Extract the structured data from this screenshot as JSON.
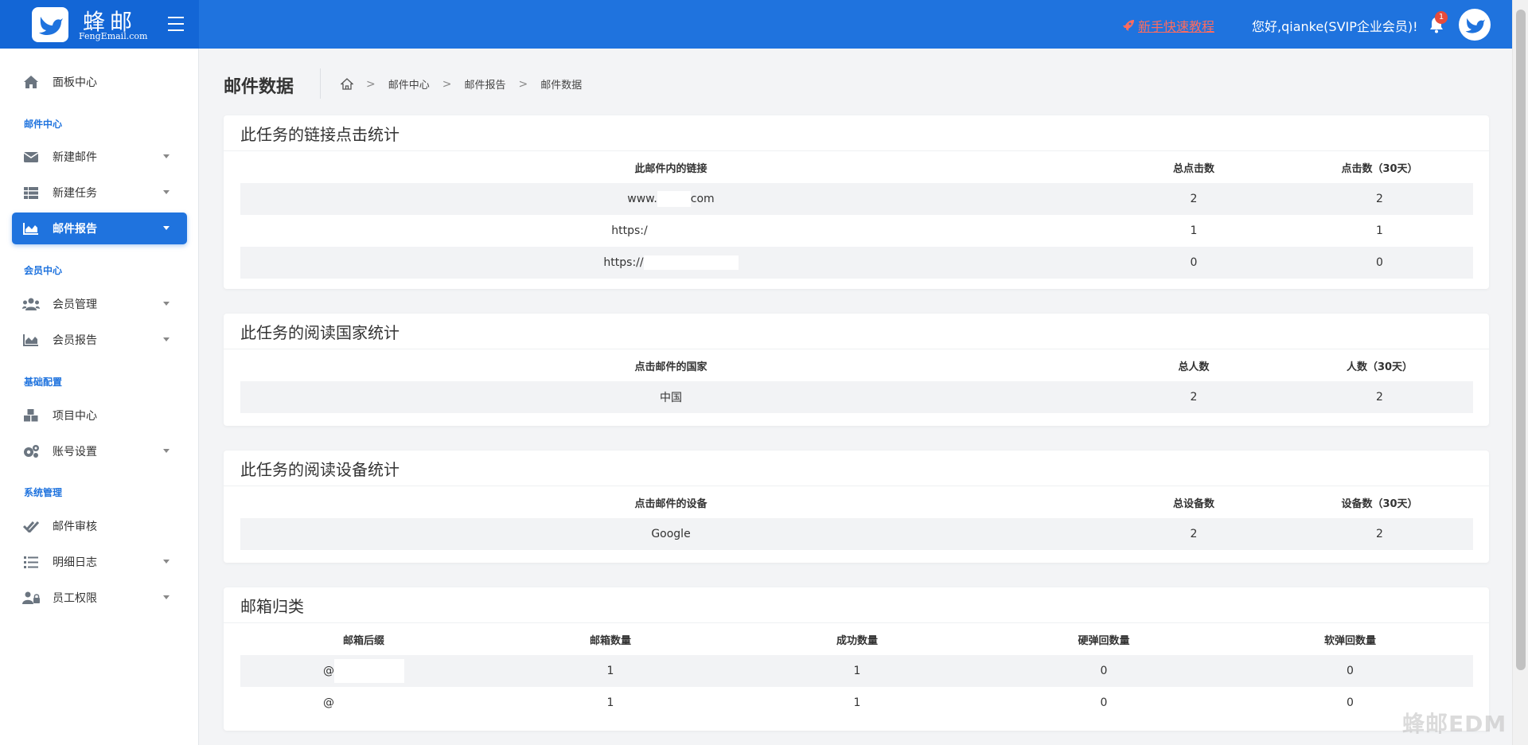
{
  "brand": {
    "name_cn": "蜂邮",
    "name_en": "FengEmail.com"
  },
  "header": {
    "tutorial": "新手快速教程",
    "greeting": "您好,qianke(SVIP企业会员)!",
    "notification_count": "1"
  },
  "sidebar": {
    "dashboard": "面板中心",
    "section_mail": "邮件中心",
    "new_mail": "新建邮件",
    "new_task": "新建任务",
    "mail_report": "邮件报告",
    "section_member": "会员中心",
    "member_manage": "会员管理",
    "member_report": "会员报告",
    "section_config": "基础配置",
    "project_center": "项目中心",
    "account_settings": "账号设置",
    "section_system": "系统管理",
    "mail_review": "邮件审核",
    "detail_log": "明细日志",
    "staff_perm": "员工权限"
  },
  "page": {
    "title": "邮件数据",
    "breadcrumb": [
      "邮件中心",
      "邮件报告",
      "邮件数据"
    ]
  },
  "links_card": {
    "title": "此任务的链接点击统计",
    "headers": [
      "此邮件内的链接",
      "总点击数",
      "点击数（30天）"
    ],
    "rows": [
      {
        "link_pre": "www.",
        "link_post": "com",
        "total": "2",
        "d30": "2"
      },
      {
        "link_pre": "https:/",
        "link_post": "",
        "total": "1",
        "d30": "1"
      },
      {
        "link_pre": "https://",
        "link_post": "",
        "total": "0",
        "d30": "0"
      }
    ]
  },
  "country_card": {
    "title": "此任务的阅读国家统计",
    "headers": [
      "点击邮件的国家",
      "总人数",
      "人数（30天）"
    ],
    "rows": [
      {
        "name": "中国",
        "total": "2",
        "d30": "2"
      }
    ]
  },
  "device_card": {
    "title": "此任务的阅读设备统计",
    "headers": [
      "点击邮件的设备",
      "总设备数",
      "设备数（30天）"
    ],
    "rows": [
      {
        "name": "Google",
        "total": "2",
        "d30": "2"
      }
    ]
  },
  "mailbox_card": {
    "title": "邮箱归类",
    "headers": [
      "邮箱后缀",
      "邮箱数量",
      "成功数量",
      "硬弹回数量",
      "软弹回数量"
    ],
    "rows": [
      {
        "suffix": "@",
        "count": "1",
        "success": "1",
        "hard": "0",
        "soft": "0"
      },
      {
        "suffix": "@",
        "count": "1",
        "success": "1",
        "hard": "0",
        "soft": "0"
      }
    ]
  },
  "watermark": "蜂邮EDM",
  "colors": {
    "primary": "#1f73de",
    "brand_bg": "#1366d6",
    "tutorial": "#ff6b5e",
    "badge": "#e74c3c"
  }
}
